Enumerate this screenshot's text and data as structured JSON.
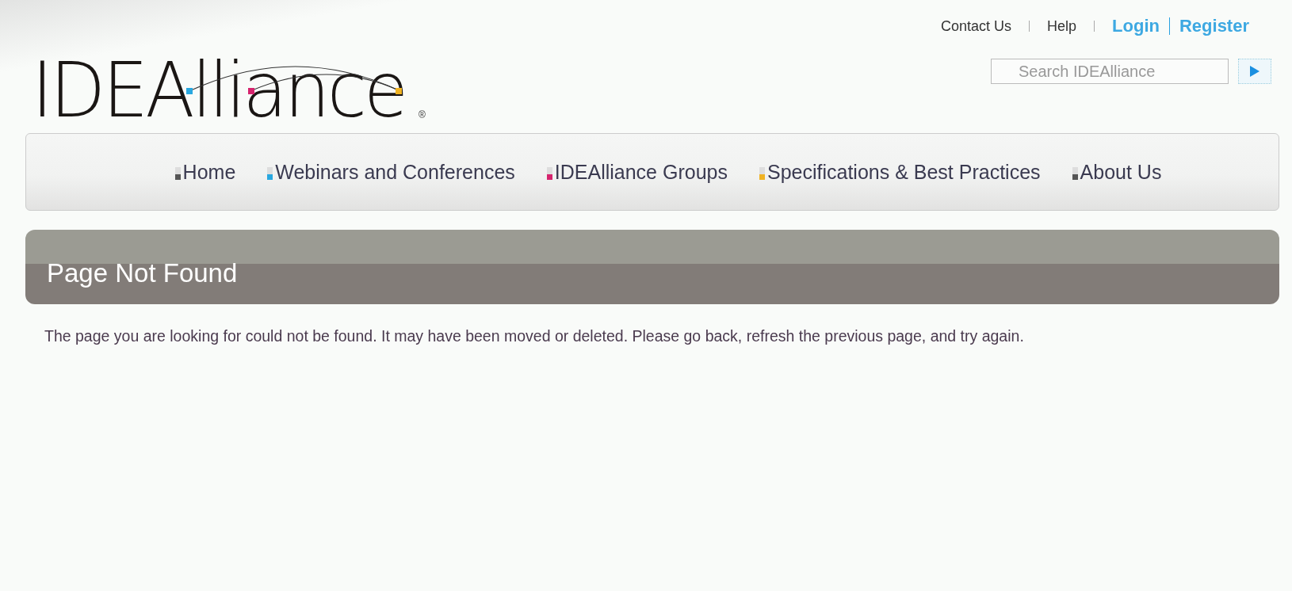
{
  "top_links": [
    {
      "label": "Contact Us",
      "kind": "plain"
    },
    {
      "label": "Help",
      "kind": "plain"
    },
    {
      "label": "Login",
      "kind": "accent"
    },
    {
      "label": "Register",
      "kind": "accent"
    }
  ],
  "logo": {
    "text": "IDEAlliance",
    "mark": "®"
  },
  "search": {
    "placeholder": "Search IDEAlliance"
  },
  "nav": [
    {
      "label": "Home",
      "color": "#555555"
    },
    {
      "label": "Webinars and Conferences",
      "color": "#29a8e0"
    },
    {
      "label": "IDEAlliance Groups",
      "color": "#d6246e"
    },
    {
      "label": "Specifications & Best Practices",
      "color": "#f0b323"
    },
    {
      "label": "About Us",
      "color": "#555555"
    }
  ],
  "page": {
    "title": "Page Not Found",
    "message": "The page you are looking for could not be found. It may have been moved or deleted. Please go back, refresh the previous page, and try again."
  }
}
